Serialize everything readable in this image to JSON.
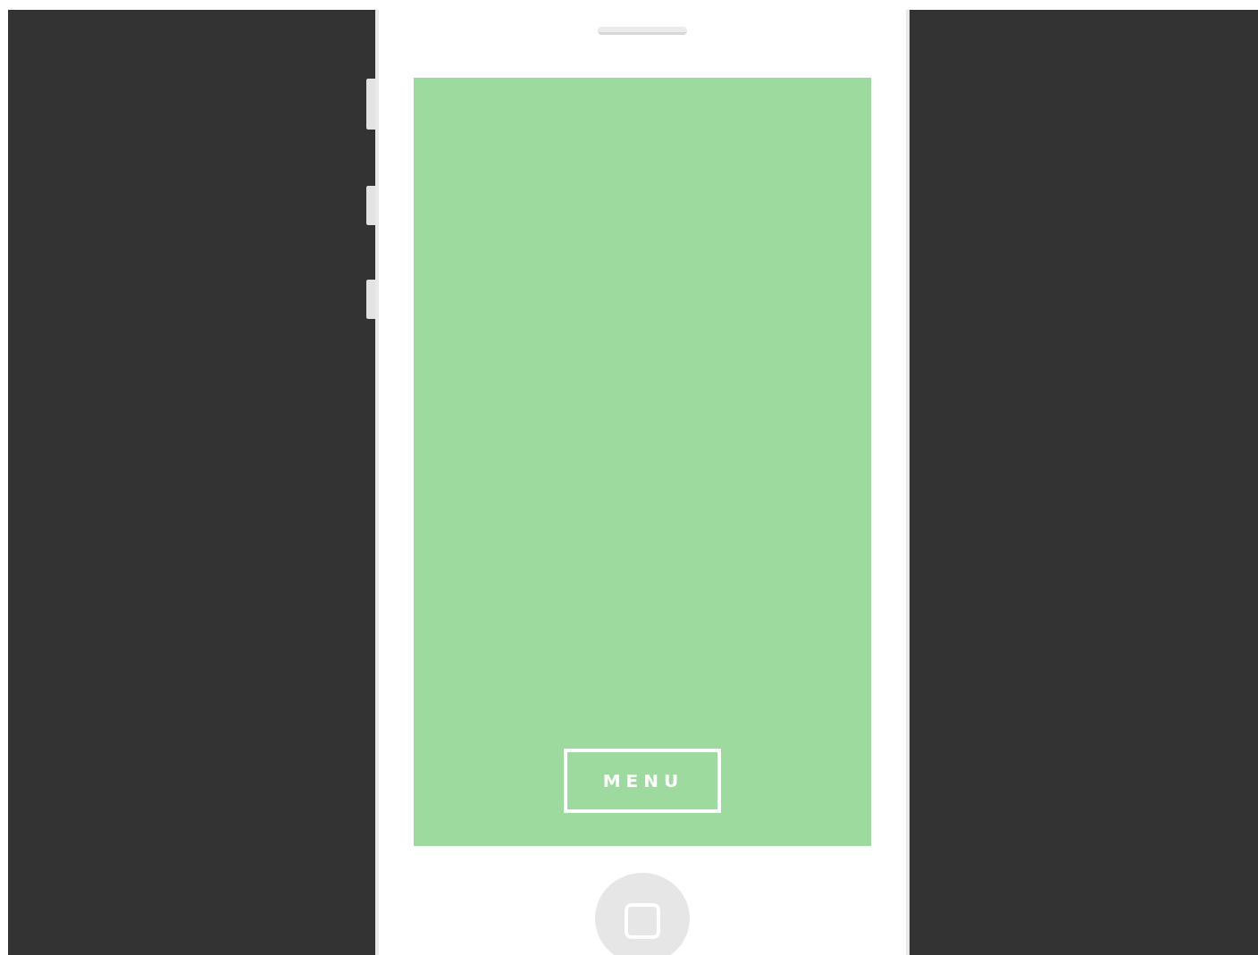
{
  "screen": {
    "menu_button": {
      "label": "MENU"
    }
  }
}
